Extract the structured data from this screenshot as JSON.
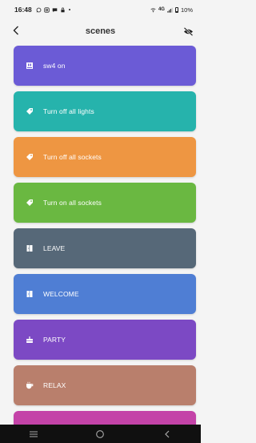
{
  "status_bar": {
    "time": "16:48",
    "network": "4G",
    "battery": "10%"
  },
  "header": {
    "title": "scenes"
  },
  "scenes": [
    {
      "label": "sw4 on",
      "color": "#6b5bd6",
      "icon": "switch-icon"
    },
    {
      "label": "Turn off all lights",
      "color": "#26b3ac",
      "icon": "tag-icon"
    },
    {
      "label": "Turn off all sockets",
      "color": "#ee9642",
      "icon": "tag-icon"
    },
    {
      "label": "Turn on all sockets",
      "color": "#6ab841",
      "icon": "tag-icon"
    },
    {
      "label": "LEAVE",
      "color": "#566878",
      "icon": "door-icon"
    },
    {
      "label": "WELCOME",
      "color": "#4f7ed4",
      "icon": "door-icon"
    },
    {
      "label": "PARTY",
      "color": "#7c49c4",
      "icon": "cake-icon"
    },
    {
      "label": "RELAX",
      "color": "#b97f6c",
      "icon": "cup-icon"
    },
    {
      "label": "",
      "color": "#c443a8",
      "icon": ""
    }
  ],
  "nav": {
    "recents": "recents-icon",
    "home": "home-icon",
    "back": "back-icon"
  }
}
